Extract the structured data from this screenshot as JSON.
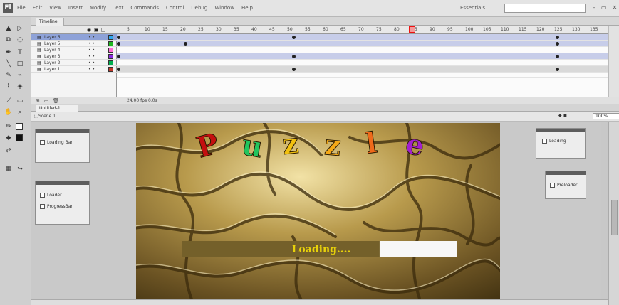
{
  "app": {
    "logo": "Fl"
  },
  "menubar": {
    "items": [
      "File",
      "Edit",
      "View",
      "Insert",
      "Modify",
      "Text",
      "Commands",
      "Control",
      "Debug",
      "Window",
      "Help"
    ],
    "workspace": "Essentials",
    "window_controls": [
      "–",
      "▭",
      "✕"
    ]
  },
  "timeline": {
    "tab": "Timeline",
    "layers": [
      {
        "name": "Layer 6",
        "color": "#2fa8f0",
        "selected": true
      },
      {
        "name": "Layer 5",
        "color": "#1fb81f",
        "selected": false
      },
      {
        "name": "Layer 4",
        "color": "#ff6ad5",
        "selected": false
      },
      {
        "name": "Layer 3",
        "color": "#8c2be2",
        "selected": false
      },
      {
        "name": "Layer 2",
        "color": "#00b050",
        "selected": false
      },
      {
        "name": "Layer 1",
        "color": "#c0392b",
        "selected": false
      }
    ],
    "ruler_ticks": [
      "5",
      "10",
      "15",
      "20",
      "25",
      "30",
      "35",
      "40",
      "45",
      "50",
      "55",
      "60",
      "65",
      "70",
      "75",
      "80",
      "85",
      "90",
      "95",
      "100",
      "105",
      "110",
      "115",
      "120",
      "125",
      "130",
      "135"
    ],
    "footer": "24.00 fps   0.0s"
  },
  "document": {
    "tab": "Untitled-1",
    "scene": "Scene 1",
    "zoom_label": "100%"
  },
  "stage": {
    "title_letters": [
      {
        "char": "P",
        "color": "#c40f0f"
      },
      {
        "char": "u",
        "color": "#22c55e"
      },
      {
        "char": "z",
        "color": "#f2c10f"
      },
      {
        "char": "z",
        "color": "#f4a816"
      },
      {
        "char": "l",
        "color": "#ef6a1a"
      },
      {
        "char": "e",
        "color": "#a21fcf"
      }
    ],
    "loading_text": "Loading....",
    "loading_progress": 0.72
  },
  "panels": {
    "library": {
      "item": "Loading Bar"
    },
    "components": {
      "items": [
        "Loader",
        "ProgressBar"
      ]
    },
    "props_a": {
      "label": "Loading"
    },
    "props_b": {
      "label": "Preloader"
    }
  },
  "icons": [
    "arrow-icon",
    "subselect-icon",
    "lasso-icon",
    "pen-icon",
    "text-icon",
    "line-icon",
    "rect-icon",
    "pencil-icon",
    "brush-icon",
    "bucket-icon",
    "eyedropper-icon",
    "eraser-icon",
    "hand-icon",
    "zoom-icon"
  ]
}
